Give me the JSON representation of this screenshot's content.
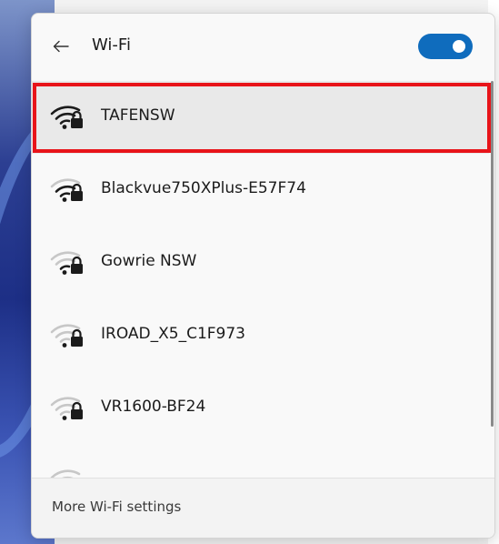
{
  "panel": {
    "title": "Wi-Fi",
    "toggle_on": true,
    "toggle_color": "#0f6cbd"
  },
  "networks": [
    {
      "name": "TAFENSW",
      "selected": true,
      "secured": true
    },
    {
      "name": "Blackvue750XPlus-E57F74",
      "selected": false,
      "secured": true
    },
    {
      "name": "Gowrie NSW",
      "selected": false,
      "secured": true
    },
    {
      "name": "IROAD_X5_C1F973",
      "selected": false,
      "secured": true
    },
    {
      "name": "VR1600-BF24",
      "selected": false,
      "secured": true
    }
  ],
  "icons": {
    "back": "back-arrow-icon",
    "network": "wifi-secured-icon"
  },
  "highlight_color": "#e8141a",
  "footer": {
    "link_label": "More Wi-Fi settings"
  }
}
